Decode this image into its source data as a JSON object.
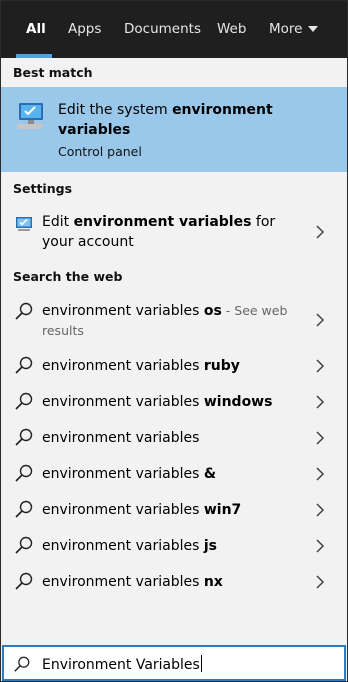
{
  "tabs": [
    {
      "label": "All",
      "active": true
    },
    {
      "label": "Apps"
    },
    {
      "label": "Documents"
    },
    {
      "label": "Web"
    },
    {
      "label": "More"
    }
  ],
  "sections": {
    "best_match": "Best match",
    "settings": "Settings",
    "search_web": "Search the web"
  },
  "best_match": {
    "title_prefix": "Edit the system ",
    "title_bold": "environment variables",
    "subtitle": "Control panel",
    "icon": "control-panel-icon"
  },
  "settings_item": {
    "prefix": "Edit ",
    "bold": "environment variables",
    "suffix": " for your account",
    "icon": "settings-monitor-icon"
  },
  "web_results": [
    {
      "prefix": "environment variables ",
      "bold": "os",
      "hint": " - See web results"
    },
    {
      "prefix": "environment variables ",
      "bold": "ruby"
    },
    {
      "prefix": "environment variables ",
      "bold": "windows"
    },
    {
      "prefix": "environment variables",
      "bold": ""
    },
    {
      "prefix": "environment variables ",
      "bold": "&"
    },
    {
      "prefix": "environment variables ",
      "bold": "win7"
    },
    {
      "prefix": "environment variables ",
      "bold": "js"
    },
    {
      "prefix": "environment variables ",
      "bold": "nx"
    }
  ],
  "search": {
    "value": "Environment Variables",
    "icon": "search-icon"
  },
  "colors": {
    "tabbar_bg": "#1f1f1f",
    "accent": "#4fa3e3",
    "selection": "#99c8ea",
    "panel_bg": "#f2f2f2"
  }
}
